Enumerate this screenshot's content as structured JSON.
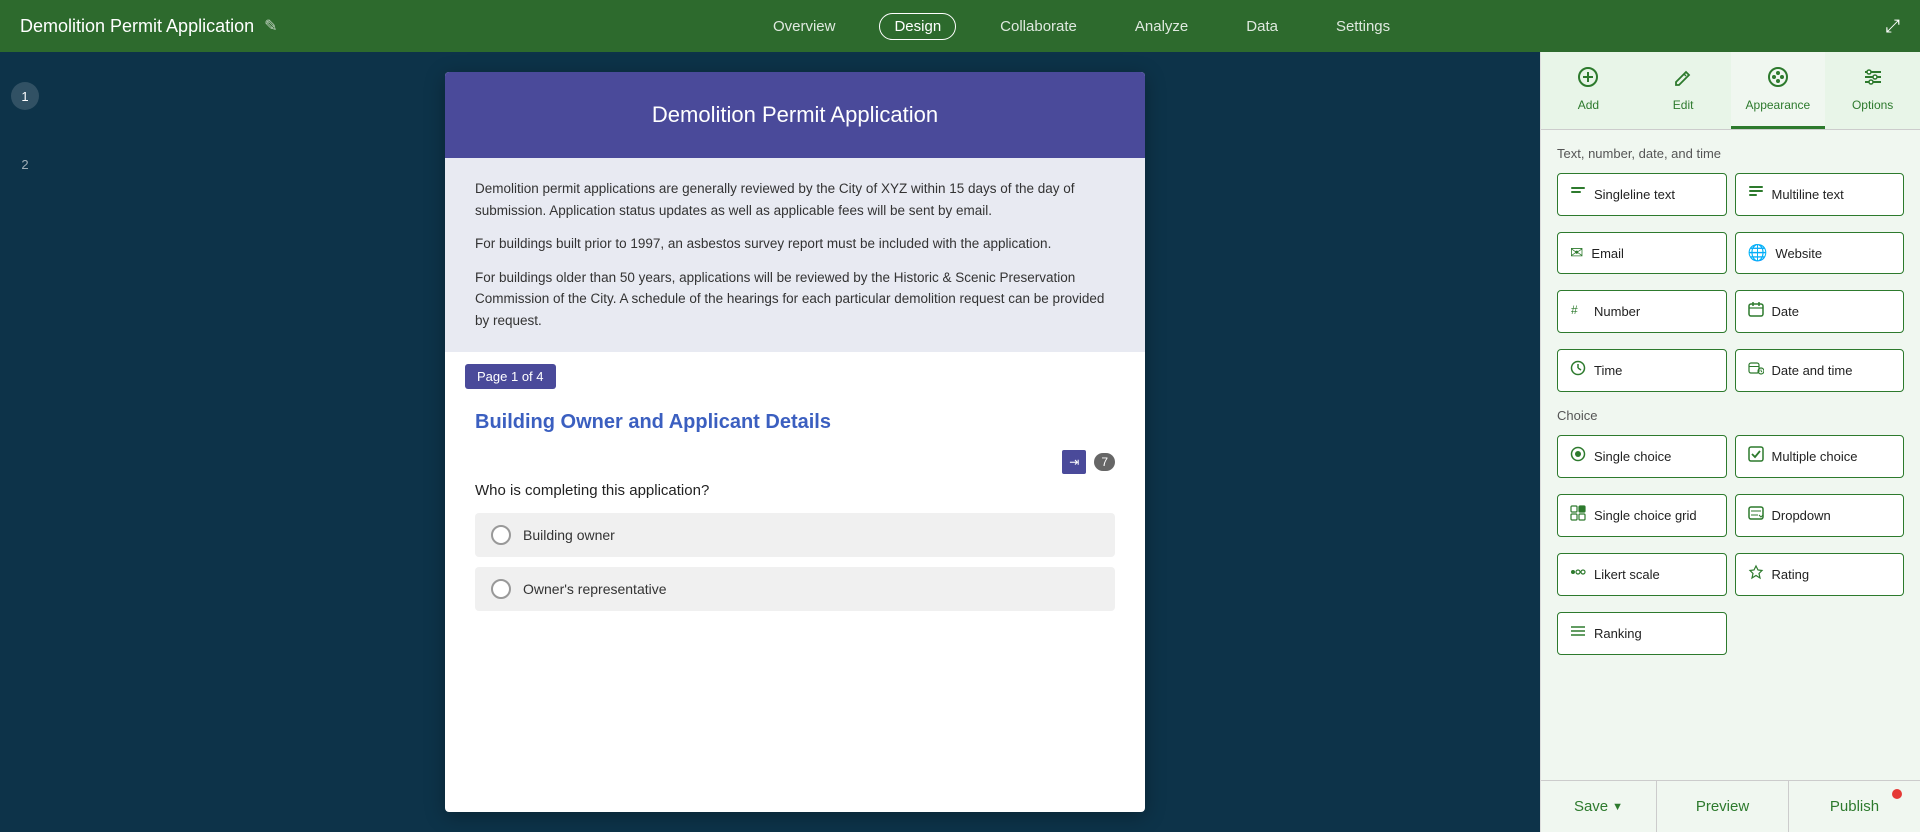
{
  "app": {
    "title": "Demolition Permit Application",
    "edit_icon": "✎"
  },
  "nav": {
    "items": [
      {
        "label": "Overview",
        "active": false
      },
      {
        "label": "Design",
        "active": true
      },
      {
        "label": "Collaborate",
        "active": false
      },
      {
        "label": "Analyze",
        "active": false
      },
      {
        "label": "Data",
        "active": false
      },
      {
        "label": "Settings",
        "active": false
      }
    ]
  },
  "form": {
    "title": "Demolition Permit Application",
    "description_p1": "Demolition permit applications are generally reviewed by the City of XYZ within 15 days of the day of submission. Application status updates as well as applicable fees will be sent by email.",
    "description_p2": "For buildings built prior to 1997, an asbestos survey report must be included with the application.",
    "description_p3": "For buildings older than 50 years, applications will be reviewed by the Historic & Scenic Preservation Commission of the City. A schedule of the hearings for each particular demolition request can be provided by request.",
    "page_indicator": "Page 1 of 4",
    "section_title": "Building Owner and Applicant Details",
    "question": "Who is completing this application?",
    "question_count": "7",
    "options": [
      {
        "label": "Building owner"
      },
      {
        "label": "Owner's representative"
      }
    ]
  },
  "panel": {
    "tabs": [
      {
        "label": "Add",
        "active": false,
        "icon": "+"
      },
      {
        "label": "Edit",
        "active": false,
        "icon": "✏"
      },
      {
        "label": "Appearance",
        "active": true,
        "icon": "🎨"
      },
      {
        "label": "Options",
        "active": false,
        "icon": "⚙"
      }
    ],
    "section1_label": "Text, number, date, and time",
    "widgets_row1": [
      {
        "label": "Singleline text",
        "icon": "≡"
      },
      {
        "label": "Multiline text",
        "icon": "☰"
      }
    ],
    "widgets_row2": [
      {
        "label": "Email",
        "icon": "✉"
      },
      {
        "label": "Website",
        "icon": "🌐"
      }
    ],
    "widgets_row3": [
      {
        "label": "Number",
        "icon": "#"
      },
      {
        "label": "Date",
        "icon": "📅"
      }
    ],
    "widgets_row4": [
      {
        "label": "Time",
        "icon": "🕐"
      },
      {
        "label": "Date and time",
        "icon": "📆"
      }
    ],
    "section2_label": "Choice",
    "widgets_row5": [
      {
        "label": "Single choice",
        "icon": "◉"
      },
      {
        "label": "Multiple choice",
        "icon": "☑"
      }
    ],
    "widgets_row6": [
      {
        "label": "Single choice grid",
        "icon": "⊞"
      },
      {
        "label": "Dropdown",
        "icon": "▤"
      }
    ],
    "widgets_row7": [
      {
        "label": "Likert scale",
        "icon": "◉◉"
      },
      {
        "label": "Rating",
        "icon": "☆"
      }
    ],
    "widgets_row8": [
      {
        "label": "Ranking",
        "icon": "≡"
      }
    ]
  },
  "bottom": {
    "save_label": "Save",
    "preview_label": "Preview",
    "publish_label": "Publish"
  },
  "page_numbers": [
    "1",
    "2"
  ]
}
